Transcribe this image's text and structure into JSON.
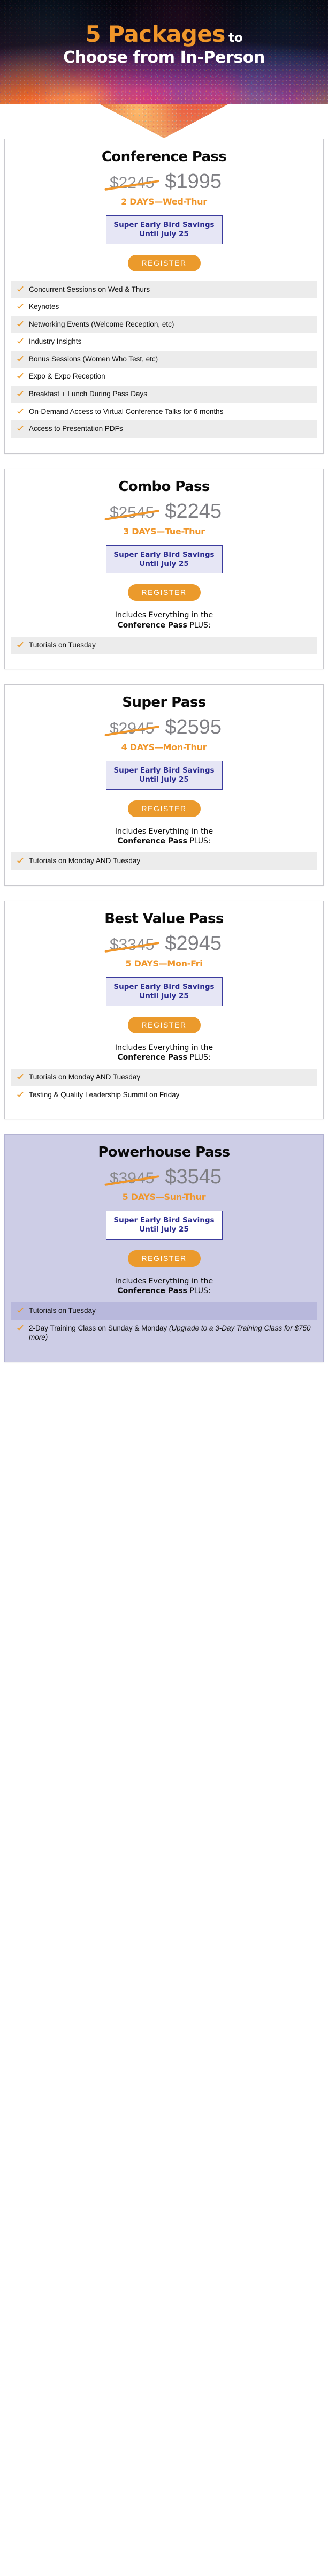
{
  "hero": {
    "line1_strong": "5 Packages",
    "line1_rest": "to",
    "line2": "Choose from In-Person"
  },
  "colors": {
    "accent_orange": "#eb9a2c",
    "savings_blue": "#2b2b8f",
    "savings_bg": "#e6e6f5",
    "featured_bg": "#cdcde6",
    "price_gray": "#7f7f84",
    "row_alt": "#ececec"
  },
  "common": {
    "register_label": "REGISTER",
    "savings_line1": "Super Early Bird Savings",
    "savings_line2": "Until July 25",
    "check_icon": "check-icon"
  },
  "packages": [
    {
      "title": "Conference Pass",
      "price_old": "$2245",
      "price_new": "$1995",
      "days": "2 DAYS—Wed-Thur",
      "includes_prefix": "",
      "includes_bold": "",
      "includes_suffix": "",
      "features": [
        "Concurrent Sessions on Wed & Thurs",
        "Keynotes",
        "Networking Events (Welcome Reception, etc)",
        "Industry Insights",
        "Bonus Sessions (Women Who Test, etc)",
        "Expo & Expo Reception",
        "Breakfast + Lunch During Pass Days",
        "On-Demand Access to Virtual Conference Talks for 6 months",
        "Access to Presentation PDFs"
      ]
    },
    {
      "title": "Combo Pass",
      "price_old": "$2545",
      "price_new": "$2245",
      "days": "3 DAYS—Tue-Thur",
      "includes_prefix": "Includes Everything in the",
      "includes_bold": "Conference Pass",
      "includes_suffix": " PLUS:",
      "features": [
        "Tutorials on Tuesday"
      ]
    },
    {
      "title": "Super Pass",
      "price_old": "$2945",
      "price_new": "$2595",
      "days": "4 DAYS—Mon-Thur",
      "includes_prefix": "Includes Everything in the",
      "includes_bold": "Conference Pass",
      "includes_suffix": " PLUS:",
      "features": [
        "Tutorials on Monday AND Tuesday"
      ]
    },
    {
      "title": "Best Value Pass",
      "price_old": "$3345",
      "price_new": "$2945",
      "days": "5 DAYS—Mon-Fri",
      "includes_prefix": "Includes Everything in the",
      "includes_bold": "Conference Pass",
      "includes_suffix": " PLUS:",
      "features": [
        "Tutorials on Monday AND Tuesday",
        "Testing & Quality Leadership Summit on Friday"
      ]
    },
    {
      "title": "Powerhouse Pass",
      "price_old": "$3945",
      "price_new": "$3545",
      "days": "5 DAYS—Sun-Thur",
      "includes_prefix": "Includes Everything in the",
      "includes_bold": "Conference Pass",
      "includes_suffix": " PLUS:",
      "featured": true,
      "features": [
        "Tutorials on Tuesday",
        "2-Day Training Class on Sunday & Monday (Upgrade to a 3-Day Training Class for $750 more)"
      ],
      "features_italic_from": [
        null,
        "(Upgrade to a 3-Day Training Class for $750 more)"
      ]
    }
  ]
}
